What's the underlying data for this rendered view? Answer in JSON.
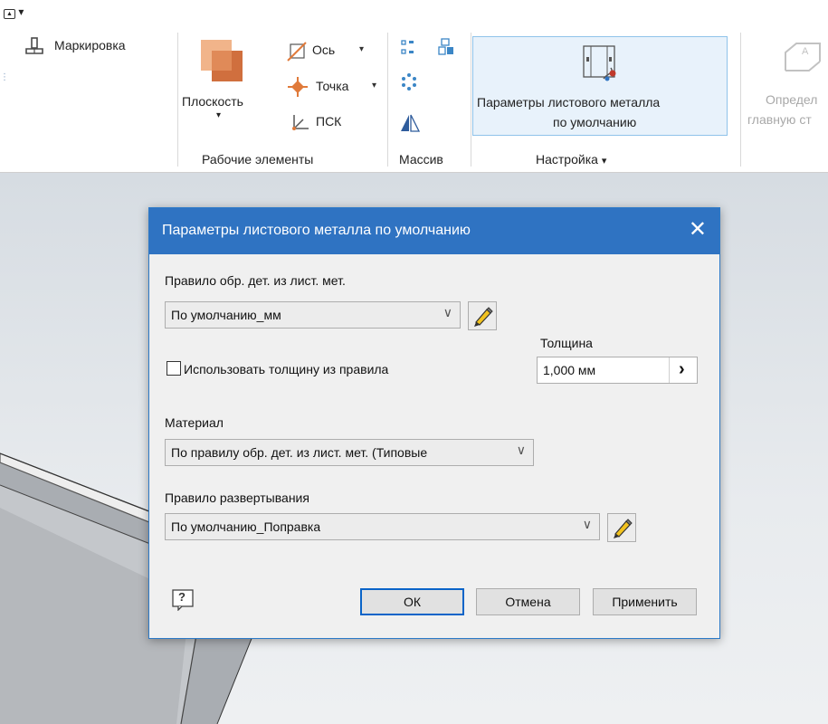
{
  "qat": {
    "icon": "ribbon-toggle-icon",
    "dropdown": "▾"
  },
  "ribbon": {
    "markup": {
      "label": "Маркировка",
      "icon": "markup-icon"
    },
    "work_features": {
      "plane": {
        "label": "Плоскость",
        "arrow": "▾",
        "icon": "plane-icon"
      },
      "axis": {
        "label": "Ось",
        "arrow": "▾",
        "icon": "axis-icon"
      },
      "point": {
        "label": "Точка",
        "arrow": "▾",
        "icon": "point-icon"
      },
      "ucs": {
        "label": "ПСК",
        "icon": "ucs-icon"
      },
      "title": "Рабочие элементы"
    },
    "pattern": {
      "title": "Массив"
    },
    "setup": {
      "button_line1": "Параметры листового металла",
      "button_line2": "по умолчанию",
      "title": "Настройка",
      "title_arrow": "▾"
    },
    "define": {
      "line1": "Определ",
      "line2": "главную ст"
    }
  },
  "dialog": {
    "title": "Параметры листового металла по умолчанию",
    "close": "✕",
    "rule_label": "Правило обр. дет. из лист. мет.",
    "rule_value": "По умолчанию_мм",
    "thickness_label": "Толщина",
    "thickness_value": "1,000 мм",
    "thickness_arrow": "›",
    "use_rule_thickness": {
      "label": "Использовать толщину из правила",
      "checked": false
    },
    "material_label": "Материал",
    "material_value": "По правилу обр. дет. из лист. мет. (Типовые",
    "unfold_label": "Правило развертывания",
    "unfold_value": "По умолчанию_Поправка",
    "combo_arrow": "∨",
    "help": "?",
    "ok": "ОК",
    "cancel": "Отмена",
    "apply": "Применить"
  },
  "colors": {
    "titlebar": "#2f73c2",
    "accent": "#0a64c8",
    "highlight": "#e8f2fb"
  }
}
